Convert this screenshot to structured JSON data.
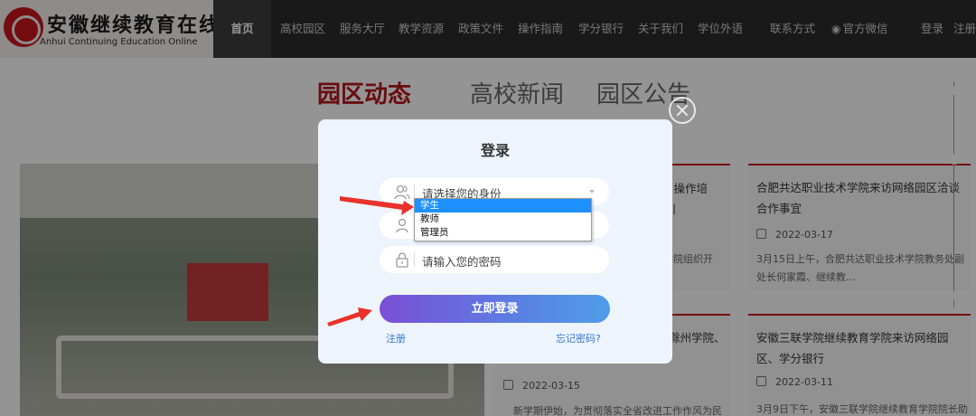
{
  "site": {
    "logo_cn": "安徽继续教育在线",
    "logo_en": "Anhui Continuing Education Online"
  },
  "nav": {
    "items": [
      "首页",
      "高校园区",
      "服务大厅",
      "教学资源",
      "政策文件",
      "操作指南",
      "学分银行",
      "关于我们",
      "学位外语",
      "联系方式",
      "官方微信"
    ],
    "active_index": 0,
    "login": "登录",
    "register": "注册"
  },
  "tabs": [
    "园区动态",
    "高校新闻",
    "园区公告"
  ],
  "news": {
    "card1": {
      "title_fragment": "” 操作培",
      "title_fragment_2": "训"
    },
    "card2": {
      "title": "合肥共达职业技术学院来访网络园区洽谈合作事宜",
      "date": "2022-03-17",
      "excerpt": "3月15日上午，合肥共达职业技术学院教务处副处长何家霞、继续教…",
      "excerpt_hidden": "学院组织开"
    },
    "card3": {
      "title_fragment": "滁州学院、",
      "date": "2022-03-15",
      "excerpt": "新学期伊始，为贯彻落实全省改进工作作风为民"
    },
    "card4": {
      "title": "安徽三联学院继续教育学院来访网络园区、学分银行",
      "date": "2022-03-11",
      "excerpt": "3月9日下午，安徽三联学院继续教育学院院长助"
    }
  },
  "modal": {
    "title": "登录",
    "identity_placeholder": "请选择您的身份",
    "password_placeholder": "请输入您的密码",
    "submit": "立即登录",
    "register_link": "注册",
    "forgot_link": "忘记密码?",
    "identity_options": [
      "学生",
      "教师",
      "管理员"
    ],
    "selected_option_index": 0
  },
  "colors": {
    "brand_red": "#b7151c",
    "nav_bg": "#2b2b2b",
    "modal_bg": "#eef4fc",
    "button_gradient_start": "#7a4fd6",
    "button_gradient_end": "#4f9de8",
    "link_blue": "#2f78d7",
    "dropdown_highlight": "#1e90ff",
    "annotation_arrow": "#e8322b"
  }
}
